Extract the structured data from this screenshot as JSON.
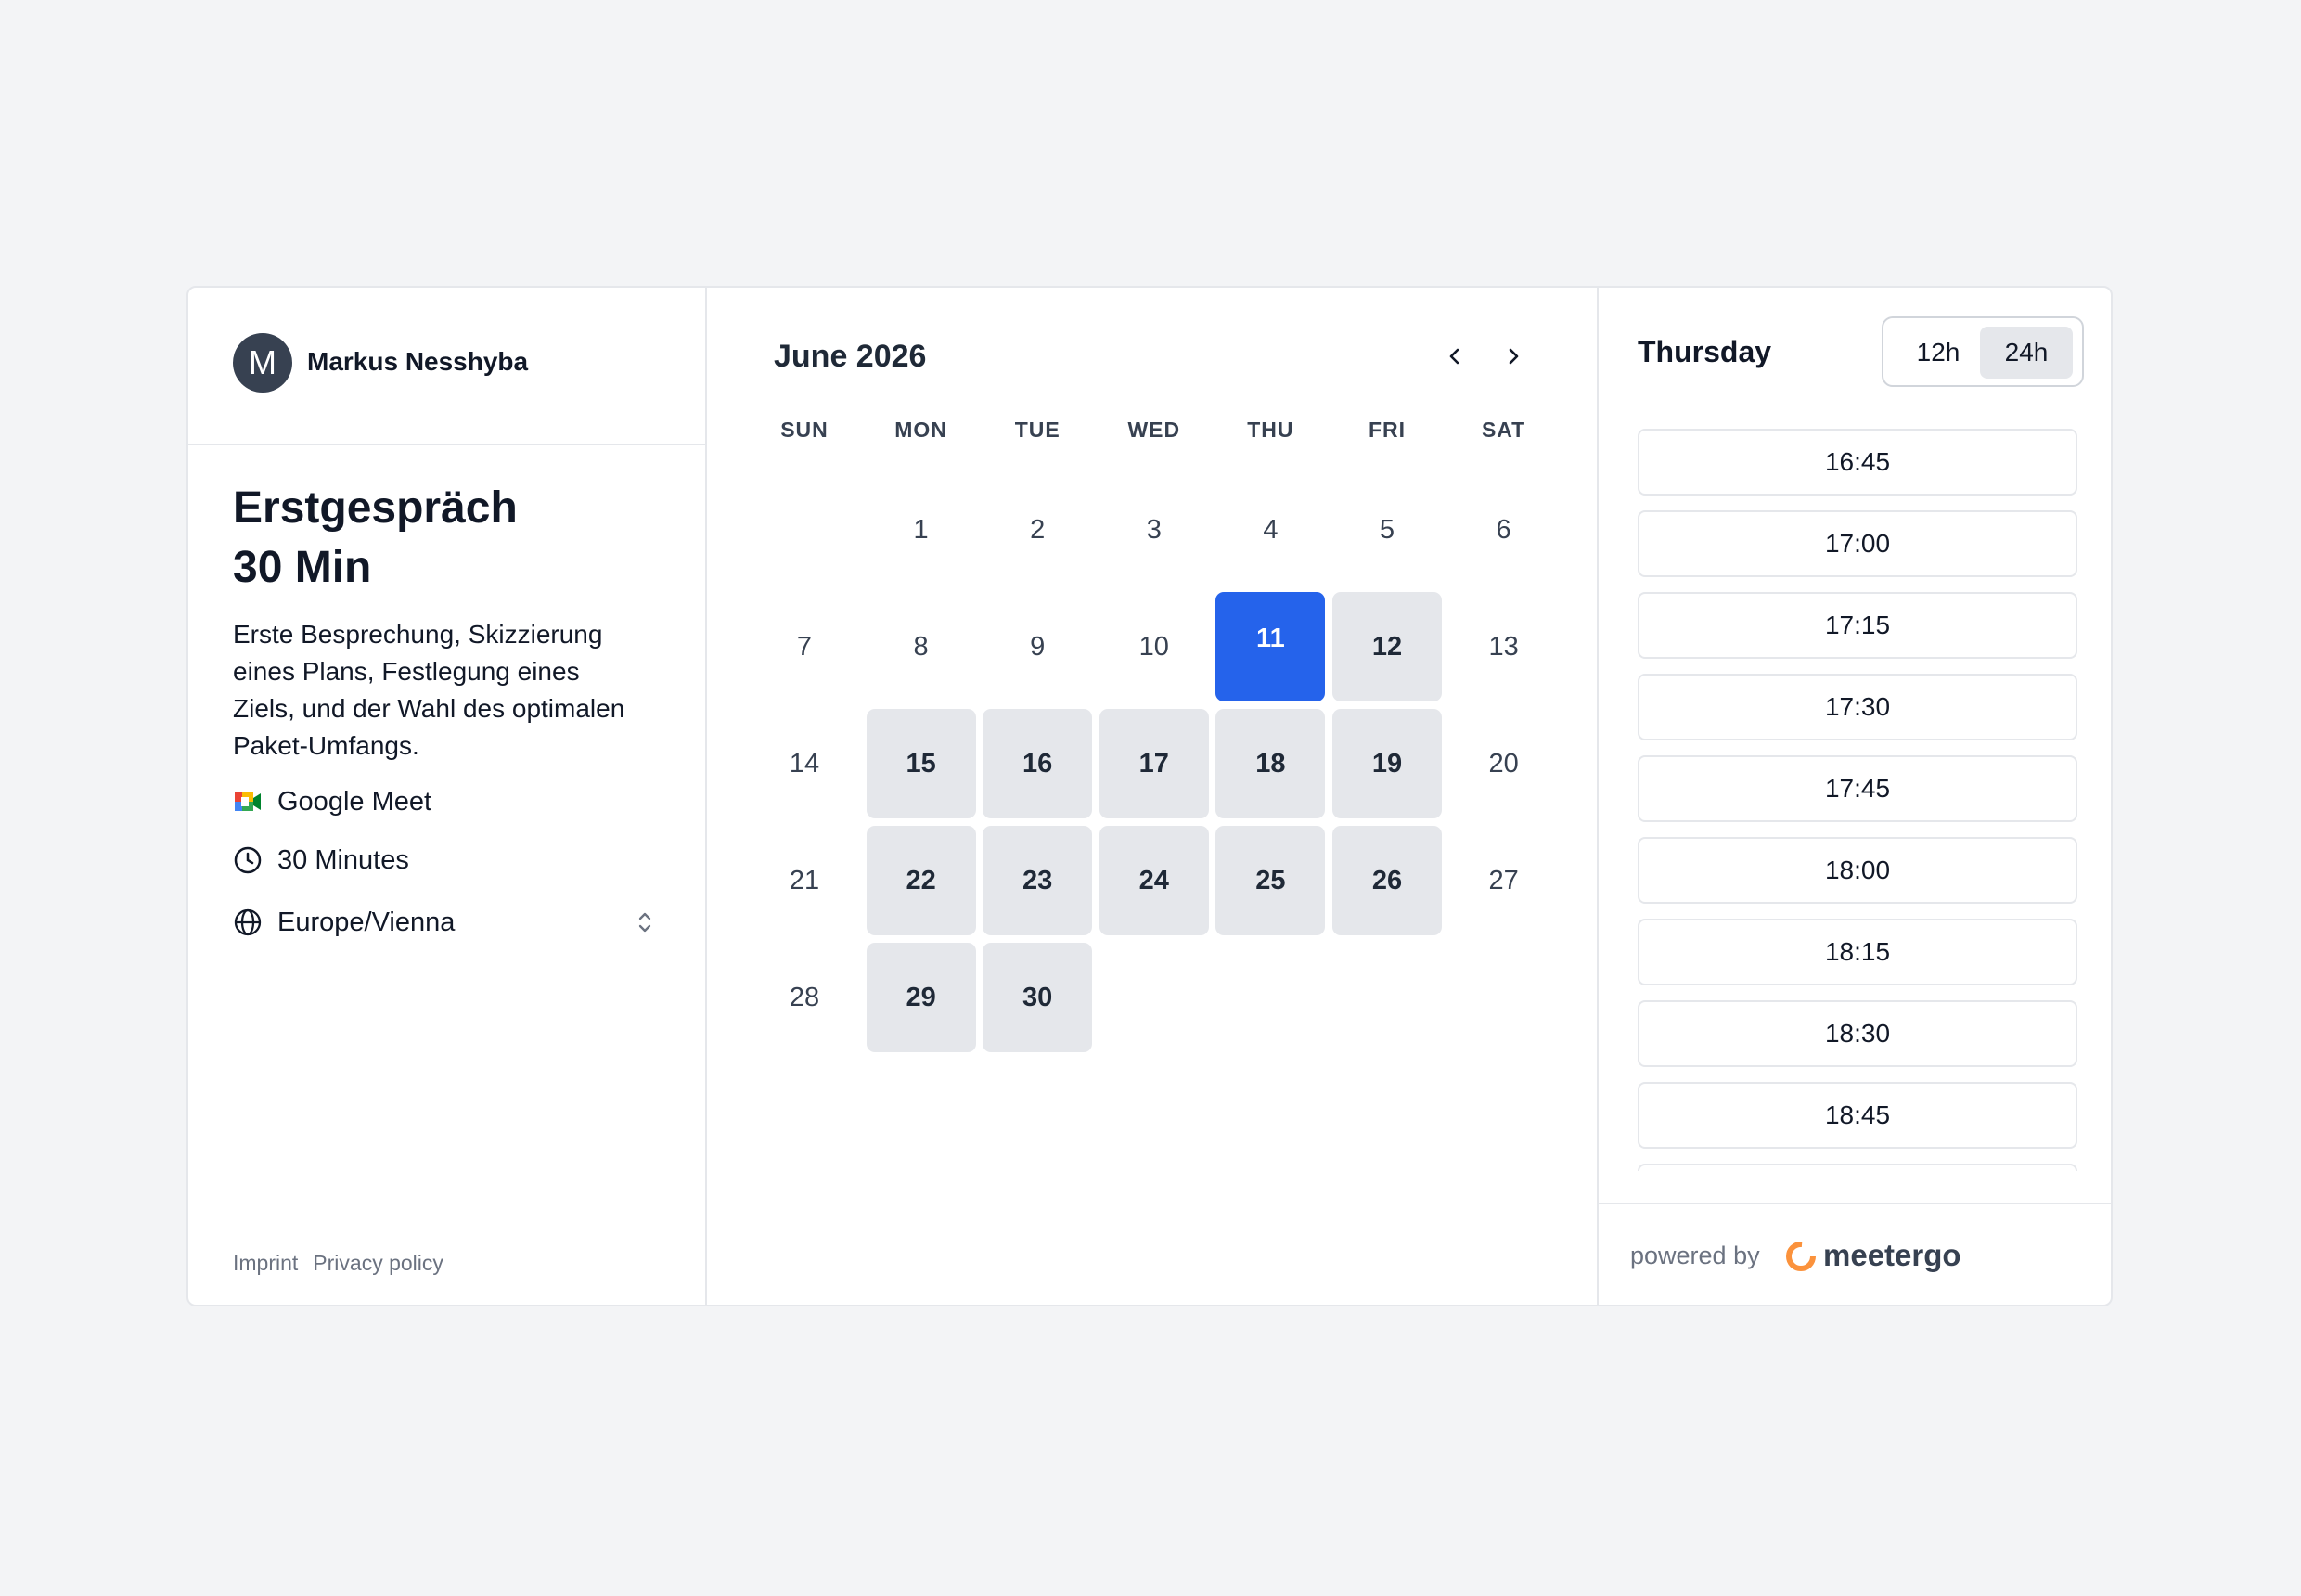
{
  "host": {
    "avatar_initial": "M",
    "name": "Markus Nesshyba"
  },
  "event": {
    "title_line1": "Erstgespräch",
    "title_line2": "30 Min",
    "description": "Erste Besprechung, Skizzierung eines Plans, Festlegung eines Ziels, und der Wahl des optimalen Paket-Umfangs.",
    "location": "Google Meet",
    "location_icon": "google-meet-icon",
    "duration": "30 Minutes",
    "duration_icon": "clock-icon",
    "timezone": "Europe/Vienna",
    "timezone_icon": "globe-icon"
  },
  "footer": {
    "imprint": "Imprint",
    "privacy": "Privacy policy"
  },
  "calendar": {
    "month_label": "June 2026",
    "weekdays": [
      "SUN",
      "MON",
      "TUE",
      "WED",
      "THU",
      "FRI",
      "SAT"
    ],
    "first_weekday_index": 1,
    "days_in_month": 30,
    "available_days": [
      12,
      15,
      16,
      17,
      18,
      19,
      22,
      23,
      24,
      25,
      26,
      29,
      30
    ],
    "selected_day": 11
  },
  "times": {
    "day_name": "Thursday",
    "format_options": [
      "12h",
      "24h"
    ],
    "active_format": "24h",
    "slots": [
      "16:45",
      "17:00",
      "17:15",
      "17:30",
      "17:45",
      "18:00",
      "18:15",
      "18:30",
      "18:45",
      ""
    ]
  },
  "branding": {
    "powered_by": "powered by",
    "brand": "meetergo",
    "brand_color": "#f59e0b"
  },
  "colors": {
    "accent": "#2563eb",
    "available_bg": "#e5e7eb",
    "page_bg": "#f3f4f6"
  }
}
